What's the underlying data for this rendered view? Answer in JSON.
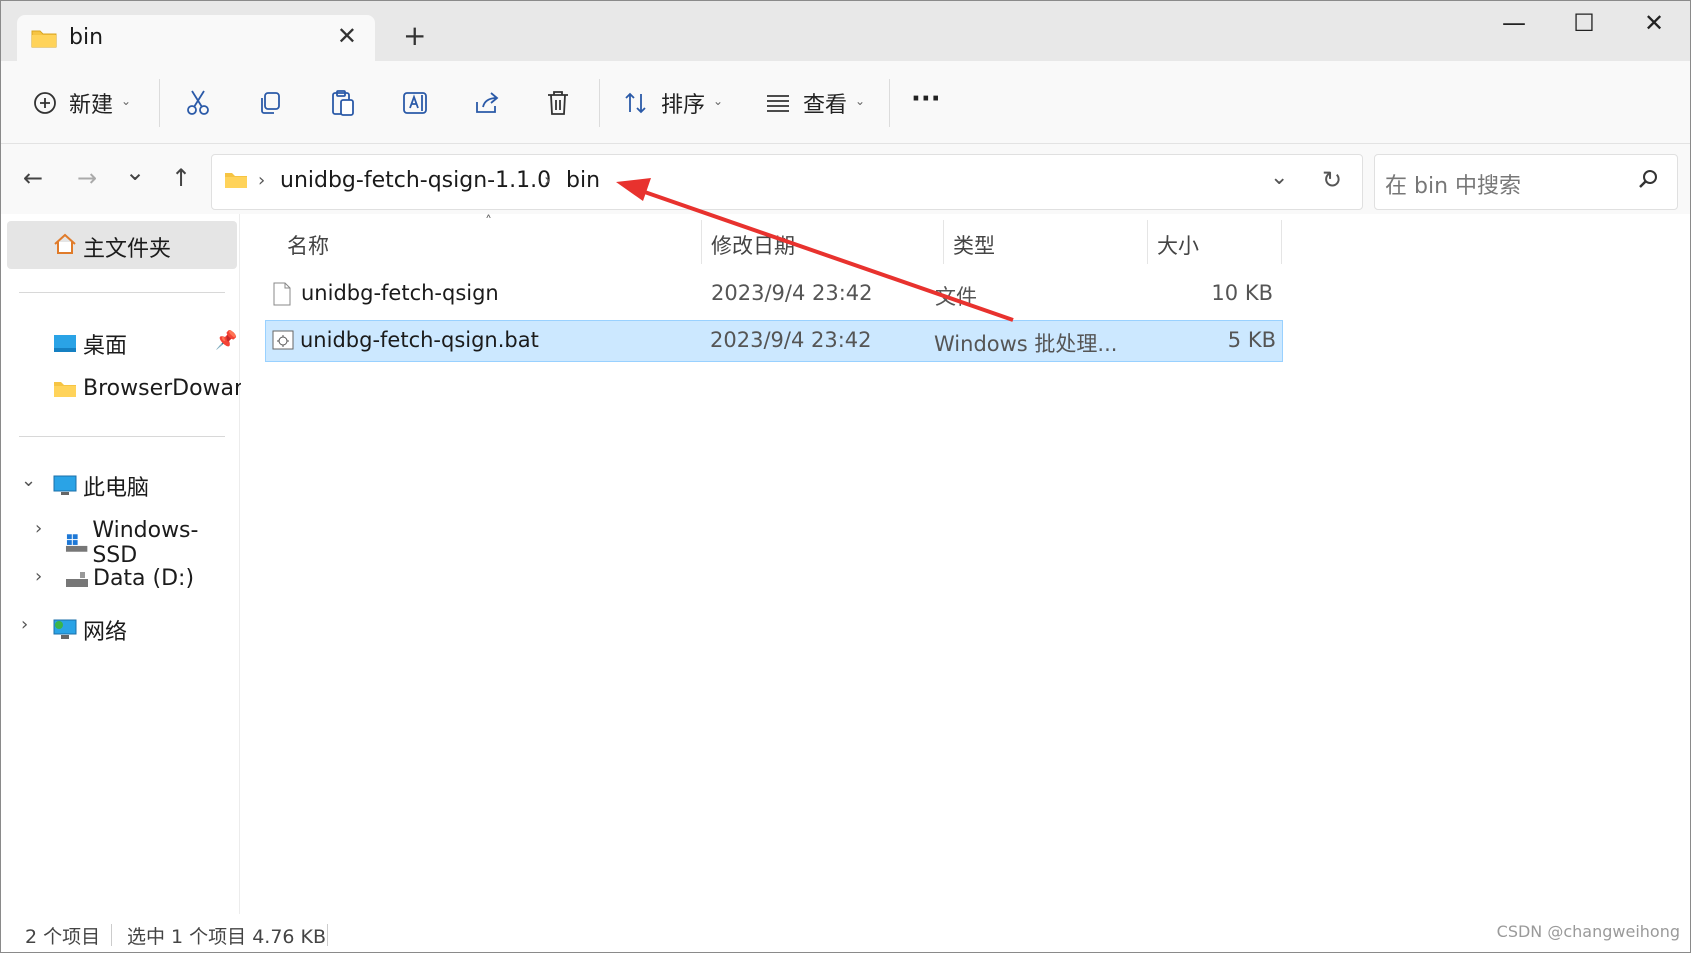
{
  "tab": {
    "title": "bin",
    "close": "✕",
    "newtab": "+"
  },
  "window_controls": {
    "minimize": "—",
    "maximize": "☐",
    "close": "✕"
  },
  "toolbar": {
    "new_label": "新建",
    "sort_label": "排序",
    "view_label": "查看",
    "more_label": "···"
  },
  "nav": {
    "back": "←",
    "forward": "→",
    "recent": "⌄",
    "up": "↑"
  },
  "address": {
    "segments": [
      "unidbg-fetch-qsign-1.1.0",
      "bin"
    ],
    "sep": "›"
  },
  "search": {
    "placeholder": "在 bin 中搜索"
  },
  "sidebar": {
    "home": "主文件夹",
    "pinned": [
      {
        "label": "桌面"
      },
      {
        "label": "BrowserDowan"
      }
    ],
    "this_pc": "此电脑",
    "drives": [
      {
        "label": "Windows-SSD"
      },
      {
        "label": "Data (D:)"
      }
    ],
    "network": "网络"
  },
  "columns": {
    "name": "名称",
    "modified": "修改日期",
    "type": "类型",
    "size": "大小"
  },
  "files": [
    {
      "name": "unidbg-fetch-qsign",
      "modified": "2023/9/4 23:42",
      "type": "文件",
      "size": "10 KB",
      "selected": false
    },
    {
      "name": "unidbg-fetch-qsign.bat",
      "modified": "2023/9/4 23:42",
      "type": "Windows 批处理...",
      "size": "5 KB",
      "selected": true
    }
  ],
  "status": {
    "count": "2 个项目",
    "selection": "选中 1 个项目  4.76 KB"
  },
  "watermark": "CSDN @changweihong"
}
